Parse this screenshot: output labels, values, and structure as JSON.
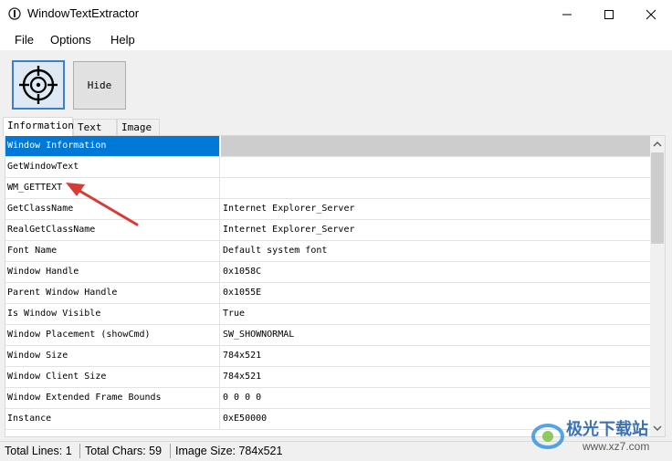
{
  "window": {
    "title": "WindowTextExtractor"
  },
  "menu": {
    "items": [
      "File",
      "Options",
      "Help"
    ]
  },
  "toolbar": {
    "hide_label": "Hide"
  },
  "tabs": [
    "Information",
    "Text",
    "Image"
  ],
  "grid": {
    "rows": [
      [
        "Window Information",
        ""
      ],
      [
        "GetWindowText",
        ""
      ],
      [
        "WM_GETTEXT",
        ""
      ],
      [
        "GetClassName",
        "Internet Explorer_Server"
      ],
      [
        "RealGetClassName",
        "Internet Explorer_Server"
      ],
      [
        "Font Name",
        "Default system font"
      ],
      [
        "Window Handle",
        "0x1058C"
      ],
      [
        "Parent Window Handle",
        "0x1055E"
      ],
      [
        "Is Window Visible",
        "True"
      ],
      [
        "Window Placement (showCmd)",
        "SW_SHOWNORMAL"
      ],
      [
        "Window Size",
        "784x521"
      ],
      [
        "Window Client Size",
        "784x521"
      ],
      [
        "Window Extended Frame Bounds",
        "0 0 0 0"
      ],
      [
        "Instance",
        "0xE50000"
      ]
    ]
  },
  "status": {
    "lines": "Total Lines: 1",
    "chars": "Total Chars: 59",
    "size": "Image Size: 784x521"
  },
  "watermark": {
    "brand": "极光下载站",
    "url": "www.xz7.com"
  },
  "colors": {
    "selection": "#0078d7",
    "arrow": "#d93a33",
    "finder_border": "#3c7fd1"
  }
}
